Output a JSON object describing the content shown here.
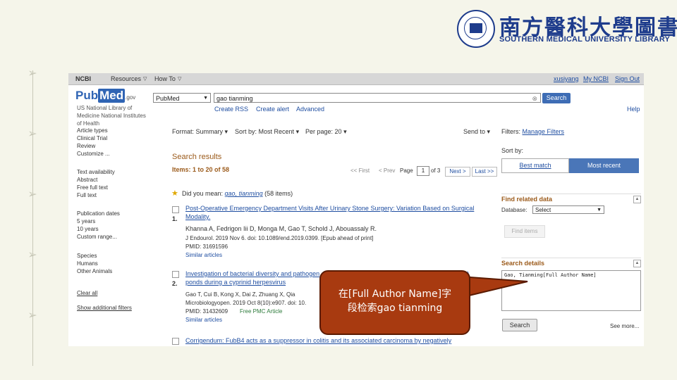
{
  "library": {
    "name_cn": "南方醫科大學圖書館",
    "name_en": "SOUTHERN MEDICAL UNIVERSITY LIBRARY"
  },
  "ncbi_bar": {
    "logo": "NCBI",
    "resources": "Resources",
    "howto": "How To",
    "user": "xusiyang",
    "my_ncbi": "My NCBI",
    "sign_out": "Sign Out"
  },
  "search": {
    "logo_pub": "Pub",
    "logo_med": "Med",
    "logo_gov": ".gov",
    "database": "PubMed",
    "query": "gao tianming",
    "button": "Search",
    "create_rss": "Create RSS",
    "create_alert": "Create alert",
    "advanced": "Advanced",
    "help": "Help"
  },
  "sidebar": {
    "nlm": [
      "US National Library of",
      "Medicine National Institutes",
      "of Health"
    ],
    "article_types": [
      "Article types",
      "Clinical Trial",
      "Review",
      "Customize ..."
    ],
    "text_availability": [
      "Text availability",
      "Abstract",
      "Free full text",
      "Full text"
    ],
    "publication_dates": [
      "Publication dates",
      "5 years",
      "10 years",
      "Custom range..."
    ],
    "species": [
      "Species",
      "Humans",
      "Other Animals"
    ],
    "clear_all": "Clear all",
    "show_additional": "Show additional filters"
  },
  "toolbar": {
    "format_label": "Format:",
    "format_value": "Summary",
    "sort_label": "Sort by:",
    "sort_value": "Most Recent",
    "per_page_label": "Per page:",
    "per_page_value": "20",
    "send_to": "Send to"
  },
  "results": {
    "title": "Search results",
    "items": "Items: 1 to 20 of 58",
    "first": "<< First",
    "prev": "< Prev",
    "page_label": "Page",
    "page_value": "1",
    "of_label": "of 3",
    "next": "Next >",
    "last": "Last >>",
    "did_you_mean_prefix": "Did you mean:",
    "did_you_mean_query": "gao, tianming",
    "did_you_mean_count": "(58 items)",
    "articles": [
      {
        "num": "1.",
        "title": "Post-Operative Emergency Department Visits After Urinary Stone Surgery: Variation Based on Surgical Modality.",
        "authors": "Khanna A, Fedrigon Iii D, Monga M, Gao T, Schold J, Abouassaly R.",
        "journal": "J Endourol. 2019 Nov 6. doi: 10.1089/end.2019.0399. [Epub ahead of print]",
        "pmid": "PMID: 31691596",
        "similar": "Similar articles"
      },
      {
        "num": "2.",
        "title": "Investigation of bacterial diversity and pathogen abundances in gibel carp (Carassius auratus gibelio) ponds during a cyprinid herpesvirus",
        "authors": "Gao T, Cui B, Kong X, Dai Z, Zhuang X, Qia",
        "journal": "Microbiologyopen. 2019 Oct 8(10):e907. doi: 10.",
        "pmid": "PMID: 31432609",
        "free_pmc": "Free PMC Article",
        "similar": "Similar articles"
      },
      {
        "num": "",
        "title": "Corrigendum: FubB4 acts as a suppressor in colitis and its associated carcinoma by negatively"
      }
    ]
  },
  "right_panel": {
    "filters_label": "Filters:",
    "manage_filters": "Manage Filters",
    "sort_by": "Sort by:",
    "best_match": "Best match",
    "most_recent": "Most recent",
    "find_related": "Find related data",
    "database_label": "Database:",
    "database_value": "Select",
    "find_items": "Find items",
    "search_details": "Search details",
    "details_text": "Gao, Tianming[Full Author Name]",
    "search_button": "Search",
    "see_more": "See more..."
  },
  "callout": {
    "text_line1": "在[Full Author Name]字",
    "text_line2": "段检索gao tianming",
    "color": "#a83a10"
  }
}
